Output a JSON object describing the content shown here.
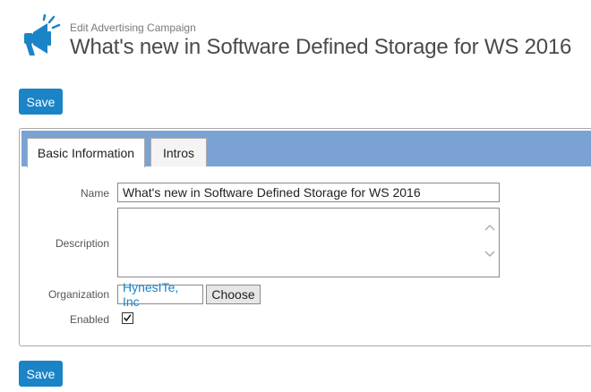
{
  "header": {
    "subtitle": "Edit Advertising Campaign",
    "title": "What's new in Software Defined Storage for WS 2016",
    "icon": "megaphone-icon"
  },
  "actions": {
    "save_label": "Save"
  },
  "tabs": [
    {
      "label": "Basic Information",
      "active": true
    },
    {
      "label": "Intros",
      "active": false
    }
  ],
  "form": {
    "name_label": "Name",
    "name_value": "What's new in Software Defined Storage for WS 2016",
    "description_label": "Description",
    "description_value": "",
    "organization_label": "Organization",
    "organization_value": "HynesITe, Inc",
    "choose_label": "Choose",
    "enabled_label": "Enabled",
    "enabled": true
  },
  "colors": {
    "accent": "#1a84c7",
    "tabbar": "#7aa3d4"
  }
}
